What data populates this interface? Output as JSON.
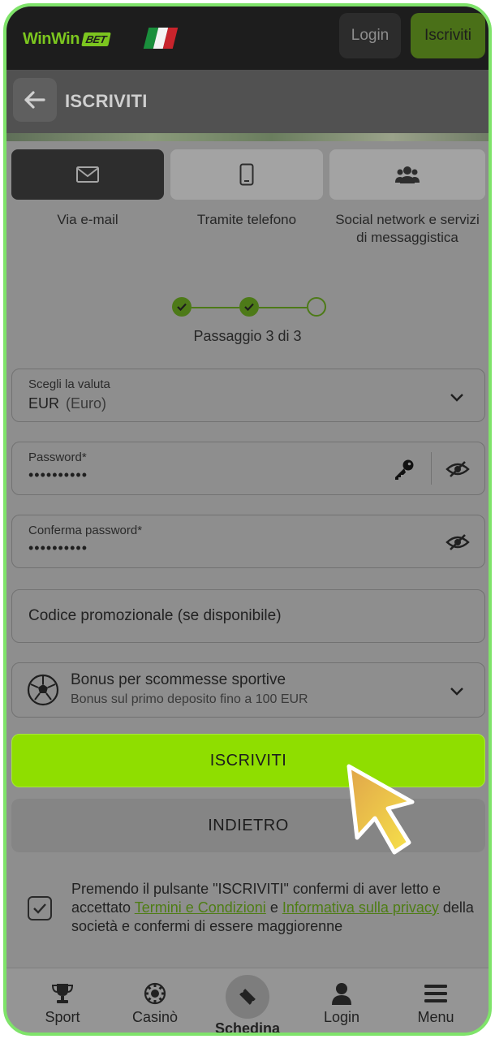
{
  "header": {
    "logo_text": "WinWin",
    "logo_badge": "BET",
    "flag_colors": [
      "#1a8f3c",
      "#f4f4f4",
      "#c8242c"
    ],
    "login_label": "Login",
    "signup_label": "Iscriviti"
  },
  "page": {
    "title": "ISCRIVITI"
  },
  "methods": [
    {
      "label": "Via e-mail",
      "icon": "envelope-icon",
      "selected": true
    },
    {
      "label": "Tramite telefono",
      "icon": "phone-icon",
      "selected": false
    },
    {
      "label": "Social network e servizi di messaggistica",
      "icon": "users-icon",
      "selected": false
    }
  ],
  "progress": {
    "text": "Passaggio 3 di 3",
    "current_step": 3,
    "total_steps": 3
  },
  "form": {
    "currency": {
      "label": "Scegli la valuta",
      "code": "EUR",
      "name": "(Euro)"
    },
    "password": {
      "label": "Password*",
      "value": "••••••••••"
    },
    "confirm_password": {
      "label": "Conferma password*",
      "value": "••••••••••"
    },
    "promo": {
      "placeholder": "Codice promozionale (se disponibile)"
    },
    "bonus": {
      "title": "Bonus per scommesse sportive",
      "subtitle": "Bonus sul primo deposito fino a 100 EUR"
    }
  },
  "actions": {
    "submit_label": "ISCRIVITI",
    "back_label": "INDIETRO"
  },
  "consent": {
    "text_before": "Premendo il pulsante \"ISCRIVITI\" confermi di aver letto e accettato ",
    "terms_link": "Termini e Condizioni",
    "connector": " e ",
    "privacy_link": "Informativa sulla privacy",
    "text_after": " della società e confermi di essere maggiorenne",
    "checked": true
  },
  "nav": {
    "sport": "Sport",
    "casino": "Casinò",
    "slip": "Schedina",
    "login": "Login",
    "menu": "Menu"
  },
  "colors": {
    "accent": "#8fde00",
    "frame": "#7fe36a",
    "link": "#4e7d14"
  }
}
